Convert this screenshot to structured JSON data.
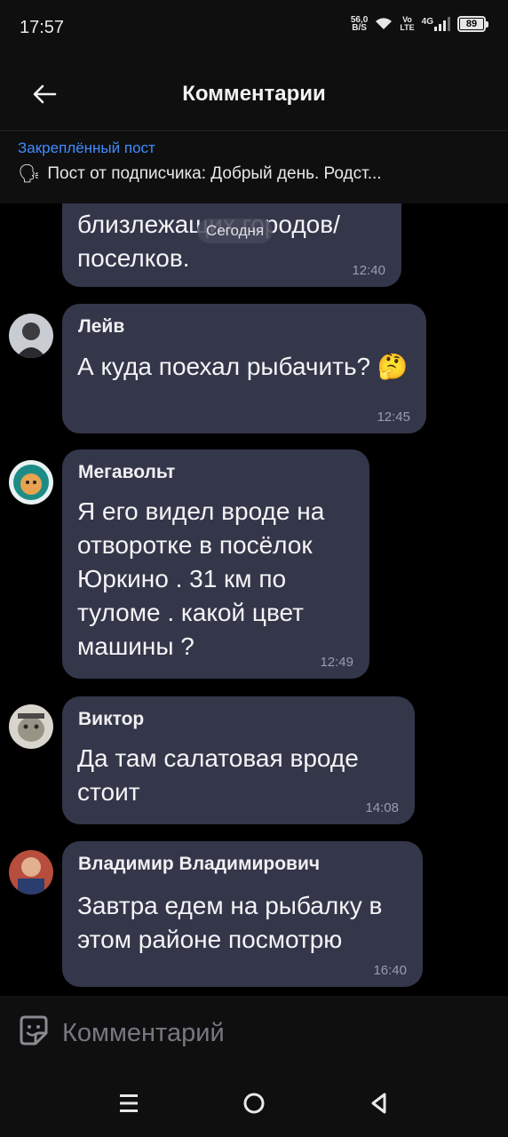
{
  "status_bar": {
    "time": "17:57",
    "net_speed_value": "56,0",
    "net_speed_unit": "B/S",
    "volte_top": "Vo",
    "volte_bottom": "LTE",
    "network": "4G",
    "battery": "89"
  },
  "header": {
    "title": "Комментарии"
  },
  "pinned": {
    "label": "Закреплённый пост",
    "text": "Пост от подписчика: Добрый день. Родст..."
  },
  "date_chip": "Сегодня",
  "messages": [
    {
      "author": "",
      "text": "близлежащих городов/ поселков.",
      "time": "12:40"
    },
    {
      "author": "Лейв",
      "text": "А куда поехал рыбачить? 🤔",
      "time": "12:45"
    },
    {
      "author": "Мегавольт",
      "text": "Я его видел вроде на отворотке в посёлок Юркино .  31 км по туломе . какой цвет машины ?",
      "time": "12:49"
    },
    {
      "author": "Виктор",
      "text": "Да там салатовая вроде стоит",
      "time": "14:08"
    },
    {
      "author": "Владимир Владимирович",
      "text": "Завтра едем на рыбалку в этом районе посмотрю",
      "time": "16:40"
    }
  ],
  "composer": {
    "placeholder": "Комментарий"
  },
  "colors": {
    "bubble": "#34364a",
    "accent": "#3f8cff",
    "background": "#000000"
  }
}
